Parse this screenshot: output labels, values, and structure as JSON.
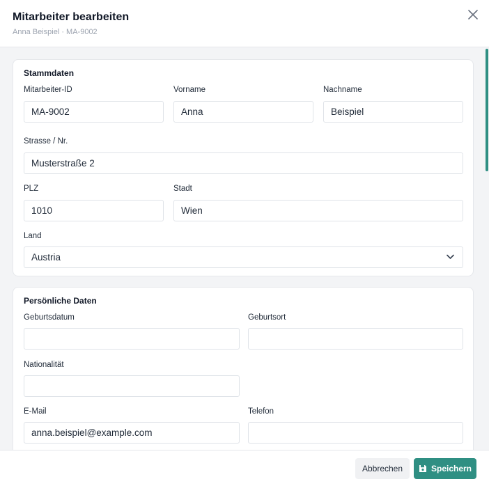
{
  "dialog": {
    "title": "Mitarbeiter bearbeiten",
    "subtitle": "Anna Beispiel · MA-9002"
  },
  "colors": {
    "accent": "#2f8f83",
    "background": "#f3f4f6"
  },
  "stammdaten": {
    "title": "Stammdaten",
    "employee_id": {
      "label": "Mitarbeiter-ID",
      "value": "MA-9002"
    },
    "first_name": {
      "label": "Vorname",
      "value": "Anna"
    },
    "last_name": {
      "label": "Nachname",
      "value": "Beispiel"
    },
    "street": {
      "label": "Strasse / Nr.",
      "value": "Musterstraße 2"
    },
    "zip": {
      "label": "PLZ",
      "value": "1010"
    },
    "city": {
      "label": "Stadt",
      "value": "Wien"
    },
    "country": {
      "label": "Land",
      "value": "Austria"
    }
  },
  "persoenlich": {
    "title": "Persönliche Daten",
    "birth_date": {
      "label": "Geburtsdatum",
      "value": ""
    },
    "birth_place": {
      "label": "Geburtsort",
      "value": ""
    },
    "nationality": {
      "label": "Nationalität",
      "value": ""
    },
    "email": {
      "label": "E-Mail",
      "value": "anna.beispiel@example.com"
    },
    "phone": {
      "label": "Telefon",
      "value": ""
    }
  },
  "footer": {
    "cancel_label": "Abbrechen",
    "save_label": "Speichern"
  },
  "icons": {
    "close": "close-icon",
    "chevron": "chevron-down-icon",
    "save": "floppy-disk-icon"
  }
}
